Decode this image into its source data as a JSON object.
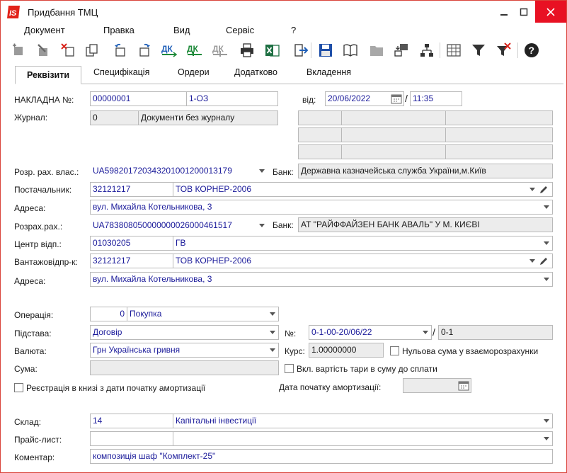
{
  "window": {
    "title": "Придбання ТМЦ"
  },
  "menu": {
    "document": "Документ",
    "edit": "Правка",
    "view": "Вид",
    "service": "Сервіс",
    "help": "?"
  },
  "tabs": [
    "Реквізити",
    "Специфікація",
    "Ордери",
    "Додатково",
    "Вкладення"
  ],
  "toolbar_icons": [
    "add-icon",
    "edit-icon",
    "delete-icon",
    "copy-icon",
    "undo-icon",
    "redo-icon",
    "dk-icon",
    "dk-check-icon",
    "dk-gray-icon",
    "print-icon",
    "excel-icon",
    "exit-icon",
    "save-icon",
    "book-icon",
    "folder-icon",
    "transfer-icon",
    "tree-icon",
    "table-icon",
    "filter-icon",
    "filter-clear-icon",
    "help-icon"
  ],
  "form": {
    "invoice_label": "НАКЛАДНА №:",
    "invoice_number": "00000001",
    "invoice_code": "1-ОЗ",
    "date_label": "від:",
    "date": "20/06/2022",
    "time": "11:35",
    "journal_label": "Журнал:",
    "journal_number": "0",
    "journal_name": "Документи без журналу",
    "own_account_label": "Розр. рах. влас.:",
    "own_account": "UA598201720343201001200013179",
    "bank_label": "Банк:",
    "own_bank": "Державна казначейська служба України,м.Київ",
    "supplier_label": "Постачальник:",
    "supplier_code": "32121217",
    "supplier_name": "ТОВ КОРНЕР-2006",
    "address_label": "Адреса:",
    "supplier_address": "вул. Михайла Котельникова, 3",
    "supplier_account_label": "Розрах.рах.:",
    "supplier_account": "UA783808050000000026000461517",
    "supplier_bank_label": "Банк:",
    "supplier_bank": "АТ \"РАЙФФАЙЗЕН БАНК АВАЛЬ\" У М. КИЄВІ",
    "center_label": "Центр відп.:",
    "center_code": "01030205",
    "center_name": "ГВ",
    "shipper_label": "Вантажовідпр-к:",
    "shipper_code": "32121217",
    "shipper_name": "ТОВ КОРНЕР-2006",
    "address2_label": "Адреса:",
    "shipper_address": "вул. Михайла Котельникова, 3",
    "operation_label": "Операція:",
    "operation_code": "0",
    "operation_name": "Покупка",
    "basis_label": "Підстава:",
    "basis": "Договір",
    "basis_no_label": "№:",
    "basis_no": "0-1-00-20/06/22",
    "basis_no2": "0-1",
    "currency_label": "Валюта:",
    "currency": "Грн Українська гривня",
    "rate_label": "Курс:",
    "rate": "1.00000000",
    "zero_sum_label": "Нульова сума у взаєморозрахунки",
    "sum_label": "Сума:",
    "tare_label": "Вкл. вартість тари в суму до сплати",
    "register_label": "Реєстрація в книзі з дати початку амортизації",
    "amort_date_label": "Дата початку амортизації:",
    "warehouse_label": "Склад:",
    "warehouse_code": "14",
    "warehouse_name": "Капітальні інвестиції",
    "pricelist_label": "Прайс-лист:",
    "comment_label": "Коментар:",
    "comment": "композиція шаф \"Комплект-25\""
  }
}
